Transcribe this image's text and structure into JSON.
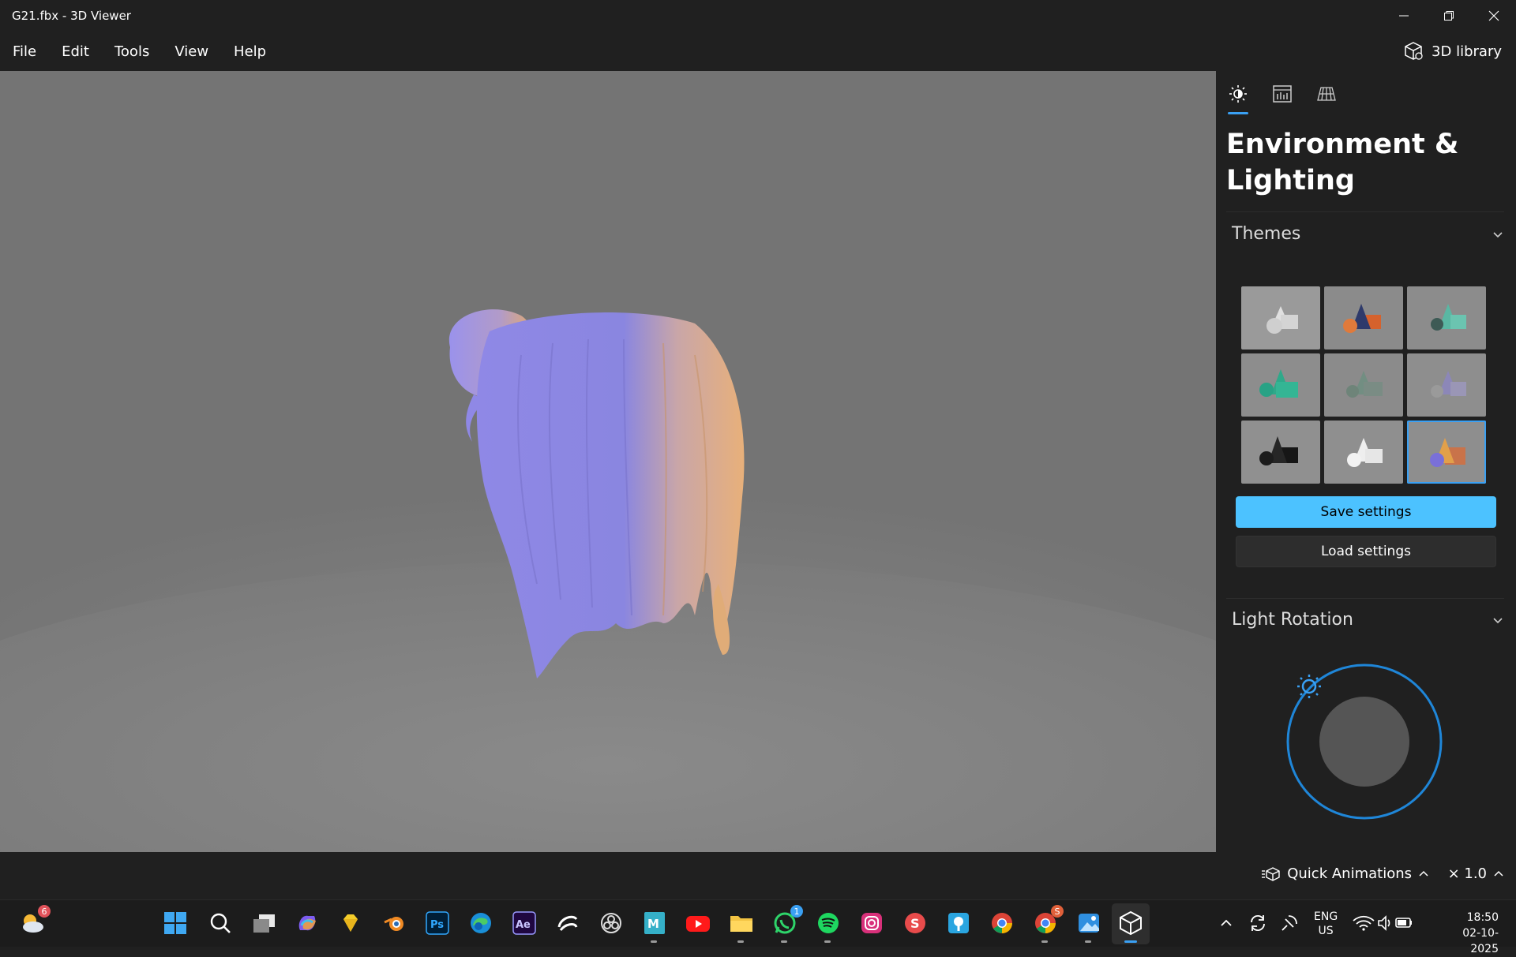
{
  "window": {
    "title": "G21.fbx - 3D Viewer"
  },
  "menu": {
    "items": [
      "File",
      "Edit",
      "Tools",
      "View",
      "Help"
    ],
    "library_label": "3D library"
  },
  "panel": {
    "title_line1": "Environment &",
    "title_line2": "Lighting",
    "themes_label": "Themes",
    "save_label": "Save settings",
    "load_label": "Load settings",
    "light_rotation_label": "Light Rotation",
    "accent": "#3aa0f3"
  },
  "bottom": {
    "quick_animations_label": "Quick Animations",
    "speed_label": "× 1.0"
  },
  "taskbar": {
    "weather_badge": "6",
    "whatsapp_badge": "1",
    "chrome_badge": "S",
    "language": "ENG",
    "region": "US",
    "time": "18:50",
    "date": "02-10-2025"
  }
}
